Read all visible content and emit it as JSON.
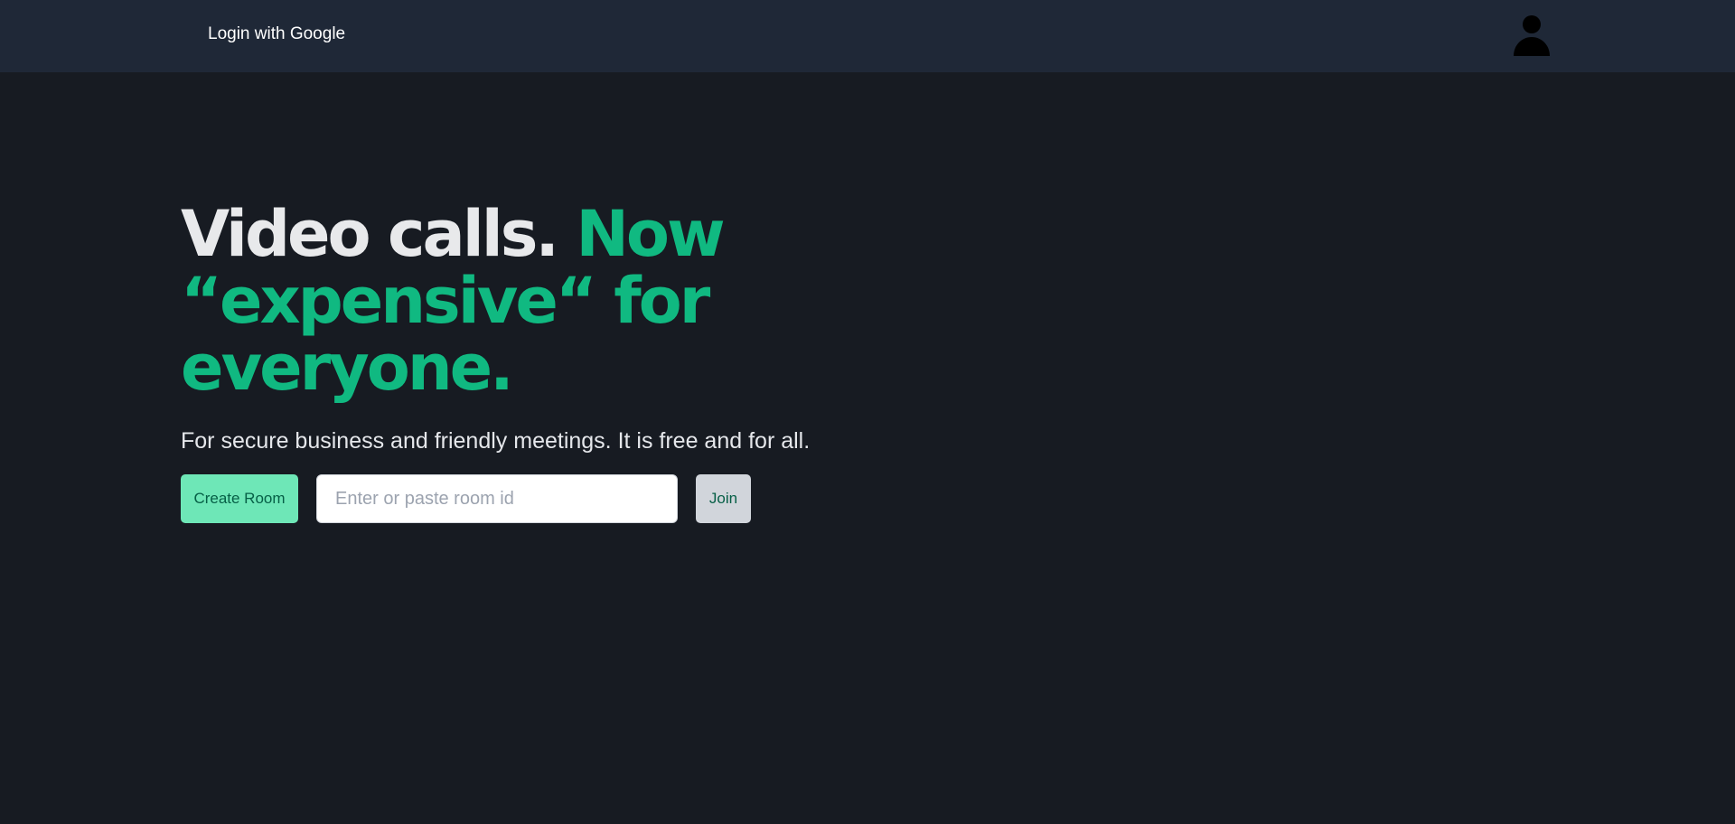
{
  "header": {
    "login_label": "Login with Google",
    "avatar_icon": "user-icon"
  },
  "hero": {
    "headline_white": "Video calls.",
    "headline_green_1": "Now",
    "headline_green_2": "“expensive“ for",
    "headline_green_3": "everyone.",
    "subtitle": "For secure business and friendly meetings. It is free and for all."
  },
  "actions": {
    "create_label": "Create Room",
    "room_input_value": "",
    "room_input_placeholder": "Enter or paste room id",
    "join_label": "Join"
  },
  "colors": {
    "background": "#171b22",
    "header": "#1f2837",
    "accent": "#10b981",
    "create_button": "#6ee7b7",
    "join_button": "#d1d5db"
  }
}
